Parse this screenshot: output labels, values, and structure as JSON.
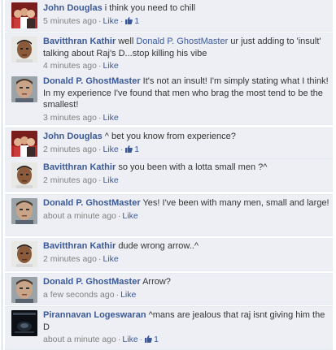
{
  "comments": [
    {
      "name": "John Douglas",
      "text": "i think you need to chill",
      "time": "5 minutes ago",
      "like": "Like",
      "like_count": "1"
    },
    {
      "name": "Bavitthran Kathir",
      "mention": "Donald P. GhostMaster",
      "text_before": "well",
      "text_after": "ur just adding to 'insult' talking about Raj's D...stop killing his vibe",
      "time": "4 minutes ago",
      "like": "Like"
    },
    {
      "name": "Donald P. GhostMaster",
      "text": "It's not an insult! I'm simply stating what I think! In my experience I've found that men who brag the most tend to be the smallest!",
      "time": "3 minutes ago",
      "like": "Like"
    },
    {
      "name": "John Douglas",
      "text": "^ bet you know from experience?",
      "time": "2 minutes ago",
      "like": "Like",
      "like_count": "1"
    },
    {
      "name": "Bavitthran Kathir",
      "text": "so you been with a lotta small men ?^",
      "time": "2 minutes ago",
      "like": "Like"
    },
    {
      "name": "Donald P. GhostMaster",
      "text": "Yes! I've been with many men, small and large!",
      "time": "about a minute ago",
      "like": "Like"
    },
    {
      "name": "Bavitthran Kathir",
      "text": "dude wrong arrow..^",
      "time": "2 minutes ago",
      "like": "Like"
    },
    {
      "name": "Donald P. GhostMaster",
      "text": "Arrow?",
      "time": "a few seconds ago",
      "like": "Like"
    },
    {
      "name": "Pirannavan Logeswaran",
      "text": "^mans are jealous that raj isnt giving him the D",
      "time": "about a minute ago",
      "like": "Like",
      "like_count": "1"
    }
  ],
  "colors": {
    "link": "#3b5998",
    "comment_bg": "#edeff4",
    "meta": "#808080"
  },
  "icons": [
    "thumbs-up-icon"
  ]
}
